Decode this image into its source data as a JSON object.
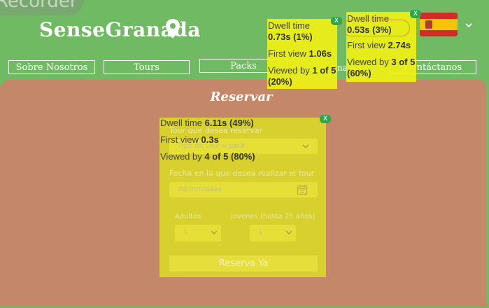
{
  "recorder": {
    "label": "Recorder"
  },
  "brand": {
    "name": "SenseGranada"
  },
  "header": {
    "nav": [
      {
        "label": "Sobre Nosotros"
      },
      {
        "label": "Tours"
      },
      {
        "label": "Packs"
      },
      {
        "label": "Contáctanos"
      }
    ],
    "nav_partial": "na"
  },
  "reservar": {
    "title": "Reservar",
    "tour_label": "Tour que desea reservar",
    "tour_placeholder": "Tipo de tour o pack",
    "date_label": "Fecha en la que desea realizar el tour",
    "date_placeholder": "dd/mm/aaaa",
    "adults_label": "Adultos",
    "adults_value": "1",
    "youth_label": "Jovenes (hasta 25 años)",
    "youth_value": "1",
    "submit": "Reserva Ya"
  },
  "overlays": [
    {
      "dwell_label": "Dwell time",
      "dwell_value": "0.73s (1%)",
      "first_label": "First view",
      "first_value": "1.06s",
      "viewed_label": "Viewed by",
      "viewed_value": "1 of 5 (20%)",
      "close": "X"
    },
    {
      "dwell_label": "Dwell time",
      "dwell_value": "0.53s (3%)",
      "first_label": "First view",
      "first_value": "2.74s",
      "viewed_label": "Viewed by",
      "viewed_value": "3 of 5 (60%)",
      "close": "X"
    },
    {
      "dwell_label": "Dwell time",
      "dwell_value": "6.11s (49%)",
      "first_label": "First view",
      "first_value": "0.3s",
      "viewed_label": "Viewed by",
      "viewed_value": "4 of 5 (80%)",
      "close": "X"
    }
  ],
  "colors": {
    "background": "#6fba63",
    "panel": "#c4876a",
    "heatmap": "#f0f014",
    "close": "#2fa64e"
  },
  "icons": {
    "pin": "map-pin-icon",
    "dropdown": "chevron-down-icon",
    "calendar": "calendar-icon",
    "flag": "spain-flag-icon"
  }
}
